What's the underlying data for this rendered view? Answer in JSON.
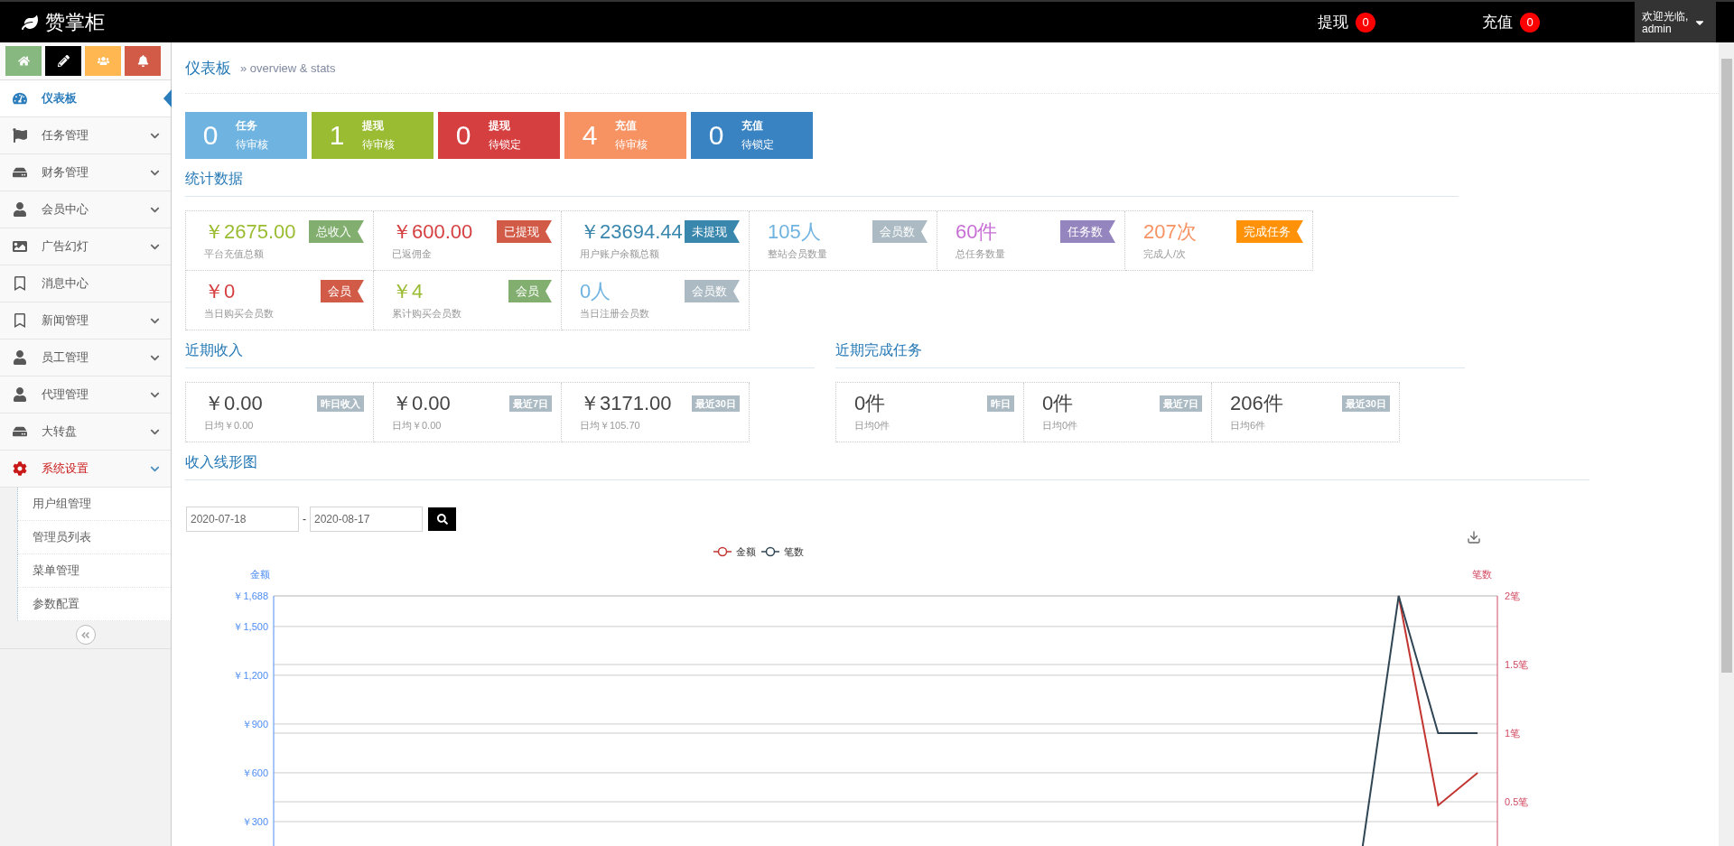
{
  "topbar": {
    "brand": "赞掌柜",
    "alerts": [
      {
        "label": "提现",
        "count": "0"
      },
      {
        "label": "充值",
        "count": "0"
      }
    ],
    "user": {
      "greeting": "欢迎光临,",
      "name": "admin"
    }
  },
  "sidebar": {
    "shortcuts": [
      {
        "color": "#87b87f"
      },
      {
        "color": "#000000"
      },
      {
        "color": "#ffb752"
      },
      {
        "color": "#d15b47"
      }
    ],
    "items": [
      {
        "label": "仪表板",
        "selected": true,
        "expanded": false,
        "has_children": false
      },
      {
        "label": "任务管理",
        "selected": false,
        "expanded": false,
        "has_children": true
      },
      {
        "label": "财务管理",
        "selected": false,
        "expanded": false,
        "has_children": true
      },
      {
        "label": "会员中心",
        "selected": false,
        "expanded": false,
        "has_children": true
      },
      {
        "label": "广告幻灯",
        "selected": false,
        "expanded": false,
        "has_children": true
      },
      {
        "label": "消息中心",
        "selected": false,
        "expanded": false,
        "has_children": false
      },
      {
        "label": "新闻管理",
        "selected": false,
        "expanded": false,
        "has_children": true
      },
      {
        "label": "员工管理",
        "selected": false,
        "expanded": false,
        "has_children": true
      },
      {
        "label": "代理管理",
        "selected": false,
        "expanded": false,
        "has_children": true
      },
      {
        "label": "大转盘",
        "selected": false,
        "expanded": false,
        "has_children": true
      },
      {
        "label": "系统设置",
        "selected": false,
        "expanded": true,
        "has_children": true,
        "children": [
          {
            "label": "用户组管理"
          },
          {
            "label": "管理员列表"
          },
          {
            "label": "菜单管理"
          },
          {
            "label": "参数配置"
          }
        ]
      }
    ]
  },
  "page_header": {
    "title": "仪表板",
    "subtitle": "» overview & stats"
  },
  "summary_tiles": [
    {
      "number": "0",
      "title": "任务",
      "subtitle": "待审核",
      "color": "#6fb3e0"
    },
    {
      "number": "1",
      "title": "提现",
      "subtitle": "待审核",
      "color": "#9abc32"
    },
    {
      "number": "0",
      "title": "提现",
      "subtitle": "待锁定",
      "color": "#d53f40"
    },
    {
      "number": "4",
      "title": "充值",
      "subtitle": "待审核",
      "color": "#f79263"
    },
    {
      "number": "0",
      "title": "充值",
      "subtitle": "待锁定",
      "color": "#3983c2"
    }
  ],
  "statistics": {
    "title": "统计数据",
    "cells": [
      {
        "value": "￥2675.00",
        "caption": "平台充值总额",
        "color": "#9abc32",
        "tag": {
          "text": "总收入",
          "color": "#82af6f"
        }
      },
      {
        "value": "￥600.00",
        "caption": "已返佣金",
        "color": "#d53f40",
        "tag": {
          "text": "已提现",
          "color": "#d15b47"
        }
      },
      {
        "value": "￥23694.44",
        "caption": "用户账户余额总额",
        "color": "#3a87ad",
        "tag": {
          "text": "未提现",
          "color": "#3a87ad"
        }
      },
      {
        "value": "105人",
        "caption": "整站会员数量",
        "color": "#6fb3e0",
        "tag": {
          "text": "会员数",
          "color": "#abbac3"
        }
      },
      {
        "value": "60件",
        "caption": "总任务数量",
        "color": "#c86fd5",
        "tag": {
          "text": "任务数",
          "color": "#9585bf"
        }
      },
      {
        "value": "207次",
        "caption": "完成人/次",
        "color": "#f79263",
        "tag": {
          "text": "完成任务",
          "color": "#ff9208"
        }
      },
      {
        "value": "￥0",
        "caption": "当日购买会员数",
        "color": "#d53f40",
        "tag": {
          "text": "会员",
          "color": "#d15b47"
        }
      },
      {
        "value": "￥4",
        "caption": "累计购买会员数",
        "color": "#9abc32",
        "tag": {
          "text": "会员",
          "color": "#82af6f"
        }
      },
      {
        "value": "0人",
        "caption": "当日注册会员数",
        "color": "#6fb3e0",
        "tag": {
          "text": "会员数",
          "color": "#abbac3"
        }
      }
    ]
  },
  "recent_income": {
    "title": "近期收入",
    "cells": [
      {
        "value": "￥0.00",
        "caption": "日均￥0.00",
        "tag": "昨日收入"
      },
      {
        "value": "￥0.00",
        "caption": "日均￥0.00",
        "tag": "最近7日"
      },
      {
        "value": "￥3171.00",
        "caption": "日均￥105.70",
        "tag": "最近30日"
      }
    ]
  },
  "recent_tasks": {
    "title": "近期完成任务",
    "cells": [
      {
        "value": "0件",
        "caption": "日均0件",
        "tag": "昨日"
      },
      {
        "value": "0件",
        "caption": "日均0件",
        "tag": "最近7日"
      },
      {
        "value": "206件",
        "caption": "日均6件",
        "tag": "最近30日"
      }
    ]
  },
  "income_chart": {
    "title": "收入线形图",
    "date_from": "2020-07-18",
    "date_to": "2020-08-17",
    "separator": "-",
    "chart_data": {
      "type": "line",
      "ylabel": "金额",
      "ylim": [
        0,
        1688
      ],
      "grid": true,
      "legend": true,
      "y2label": "笔数",
      "y2lim": [
        0,
        2
      ],
      "y2ticks": [
        {
          "value": 0.5,
          "label": "0.5笔"
        },
        {
          "value": 1,
          "label": "1笔"
        },
        {
          "value": 1.5,
          "label": "1.5笔"
        },
        {
          "value": 2,
          "label": "2笔"
        }
      ],
      "yticks": [
        {
          "value": 300,
          "label": "￥300"
        },
        {
          "value": 600,
          "label": "￥600"
        },
        {
          "value": 900,
          "label": "￥900"
        },
        {
          "value": 1200,
          "label": "￥1,200"
        },
        {
          "value": 1500,
          "label": "￥1,500"
        },
        {
          "value": 1688,
          "label": "￥1,688"
        }
      ],
      "series": [
        {
          "name": "金额",
          "color": "#c23531",
          "values": [
            null,
            null,
            null,
            null,
            null,
            null,
            null,
            null,
            null,
            null,
            null,
            null,
            null,
            null,
            null,
            null,
            null,
            null,
            null,
            null,
            null,
            null,
            null,
            null,
            null,
            null,
            null,
            null,
            1688,
            400,
            600
          ]
        },
        {
          "name": "笔数",
          "color": "#2f4554",
          "axis": "y2",
          "values": [
            null,
            null,
            null,
            null,
            null,
            null,
            null,
            null,
            null,
            null,
            null,
            null,
            null,
            null,
            null,
            null,
            null,
            null,
            null,
            null,
            null,
            null,
            null,
            null,
            null,
            null,
            null,
            0,
            2,
            1,
            1
          ]
        }
      ]
    }
  }
}
